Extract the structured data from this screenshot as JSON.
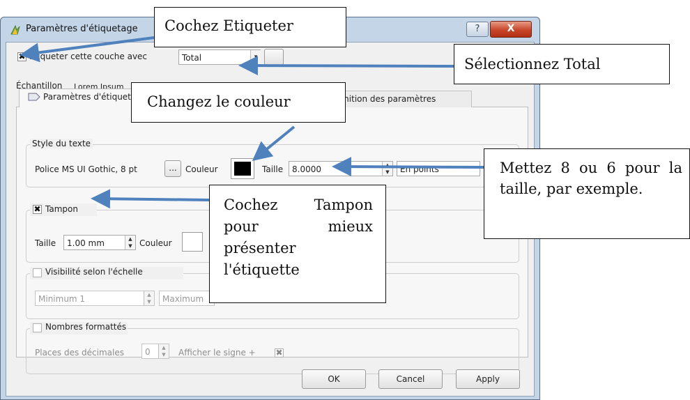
{
  "window": {
    "title": "Paramètres d'étiquetage",
    "help_label": "?",
    "close_label": "X"
  },
  "top": {
    "label_layer_check": "✖",
    "label_layer_text": "Étiqueter cette couche avec",
    "field_value": "Total",
    "sample_label": "Échantillon",
    "sample_text": "Lorem Ipsum"
  },
  "tabs": [
    {
      "label": "Paramètres d'étiquetage"
    },
    {
      "label": "Définition des paramètres"
    }
  ],
  "text_style": {
    "title": "Style du texte",
    "font_label": "Police MS UI Gothic, 8 pt",
    "font_button": "...",
    "color_label": "Couleur",
    "color_value": "#000000",
    "size_label": "Taille",
    "size_value": "8.0000",
    "unit_value": "En points"
  },
  "buffer": {
    "title": "Tampon",
    "check": "✖",
    "size_label": "Taille",
    "size_value": "1.00 mm",
    "color_label": "Couleur",
    "color_value": "#ffffff"
  },
  "scale": {
    "title": "Visibilité selon l'échelle",
    "min_value": "Minimum 1",
    "max_value": "Maximum"
  },
  "numbers": {
    "title": "Nombres formattés",
    "decimals_label": "Places des décimales",
    "decimals_value": "0",
    "sign_label": "Afficher le signe +",
    "sign_check": "✖"
  },
  "buttons": {
    "ok": "OK",
    "cancel": "Cancel",
    "apply": "Apply"
  },
  "callouts": {
    "check_label": "Cochez Etiqueter",
    "select_total": "Sélectionnez Total",
    "change_color": "Changez le couleur",
    "size_hint": "Mettez 8 ou 6 pour la taille, par exemple.",
    "buffer_hint": "Cochez Tampon pour mieux présenter l'étiquette"
  },
  "colors": {
    "arrow": "#4f81bd",
    "title_bar": "#c5d5e8",
    "client_bg": "#f0f0f0"
  }
}
